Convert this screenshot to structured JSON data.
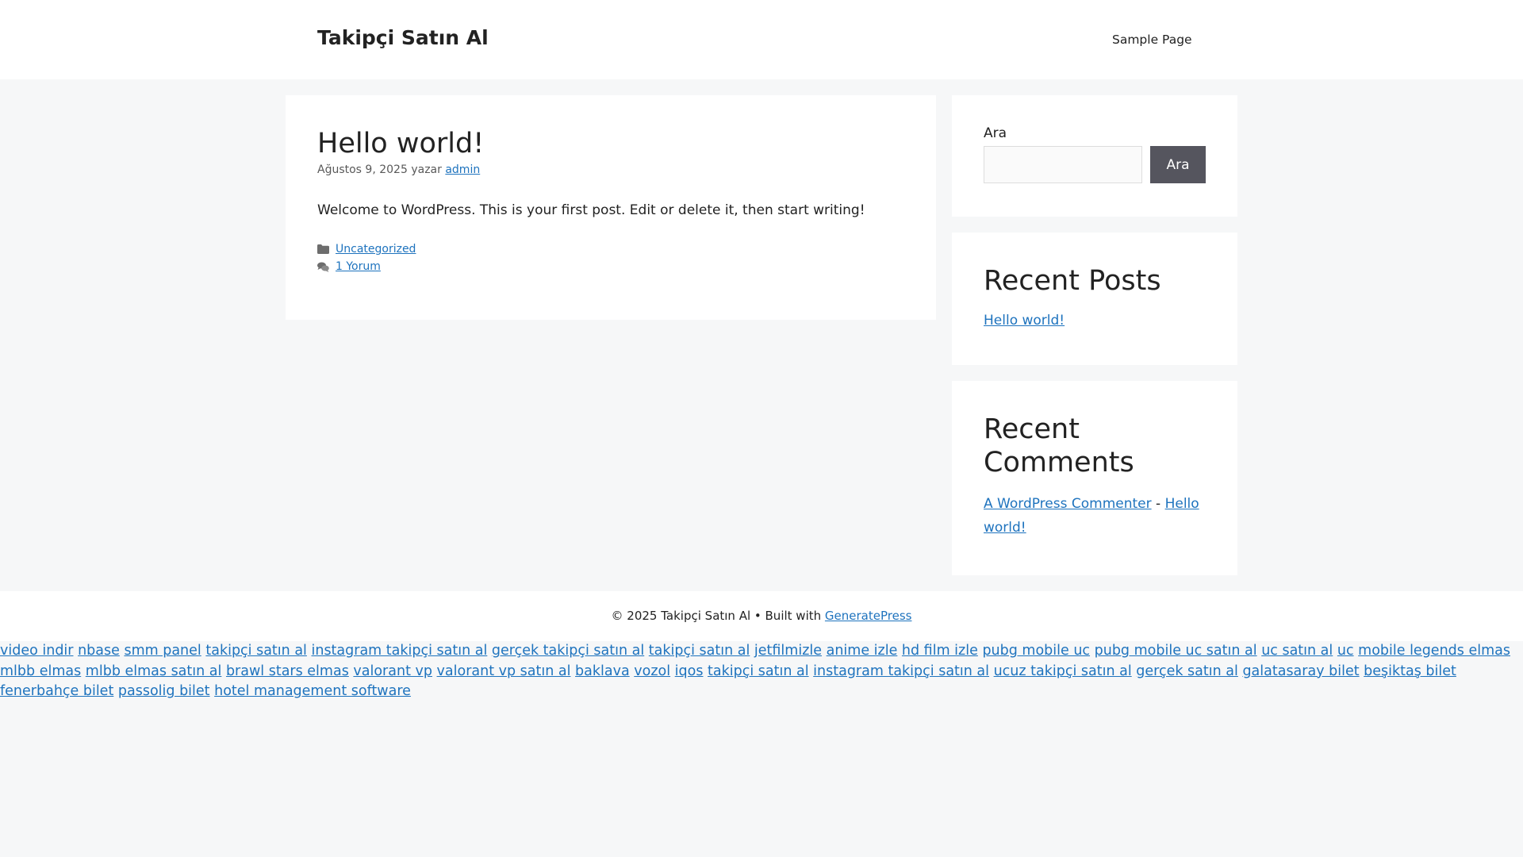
{
  "header": {
    "site_title": "Takipçi Satın Al",
    "nav_items": [
      "Sample Page"
    ]
  },
  "post": {
    "title": "Hello world!",
    "date": "Ağustos 9, 2025",
    "by_word": "yazar",
    "author": "admin",
    "content": "Welcome to WordPress. This is your first post. Edit or delete it, then start writing!",
    "category": "Uncategorized",
    "comments_link": "1 Yorum",
    "category_icon": "folder-icon",
    "comments_icon": "comments-icon"
  },
  "sidebar": {
    "search": {
      "label": "Ara",
      "button_label": "Ara",
      "input_value": "",
      "button_color": "#55555e"
    },
    "recent_posts": {
      "title": "Recent Posts",
      "items": [
        "Hello world!"
      ]
    },
    "recent_comments": {
      "title": "Recent Comments",
      "commenter": "A WordPress Commenter",
      "separator": "-",
      "post": "Hello world!"
    }
  },
  "footer": {
    "copyright": "© 2025 Takipçi Satın Al • Built with",
    "theme_link": "GeneratePress"
  },
  "footer_links": [
    "video indir",
    "nbase",
    "smm panel",
    "takipçi satın al",
    "instagram takipçi satın al",
    "gerçek takipçi satın al",
    "takipçi satın al",
    "jetfilmizle",
    "anime izle",
    "hd film izle",
    "pubg mobile uc",
    "pubg mobile uc satın al",
    "uc satın al",
    "uc",
    "mobile legends elmas",
    "mlbb elmas",
    "mlbb elmas satın al",
    "brawl stars elmas",
    "valorant vp",
    "valorant vp satın al",
    "baklava",
    "vozol",
    "iqos",
    "takipçi satın al",
    "instagram takipçi satın al",
    "ucuz takipçi satın al",
    "gerçek satın al",
    "galatasaray bilet",
    "beşiktaş bilet",
    "fenerbahçe bilet",
    "passolig bilet",
    "hotel management software"
  ],
  "colors": {
    "link": "#1e73be",
    "background": "#f6f7f8",
    "text": "#222222"
  }
}
